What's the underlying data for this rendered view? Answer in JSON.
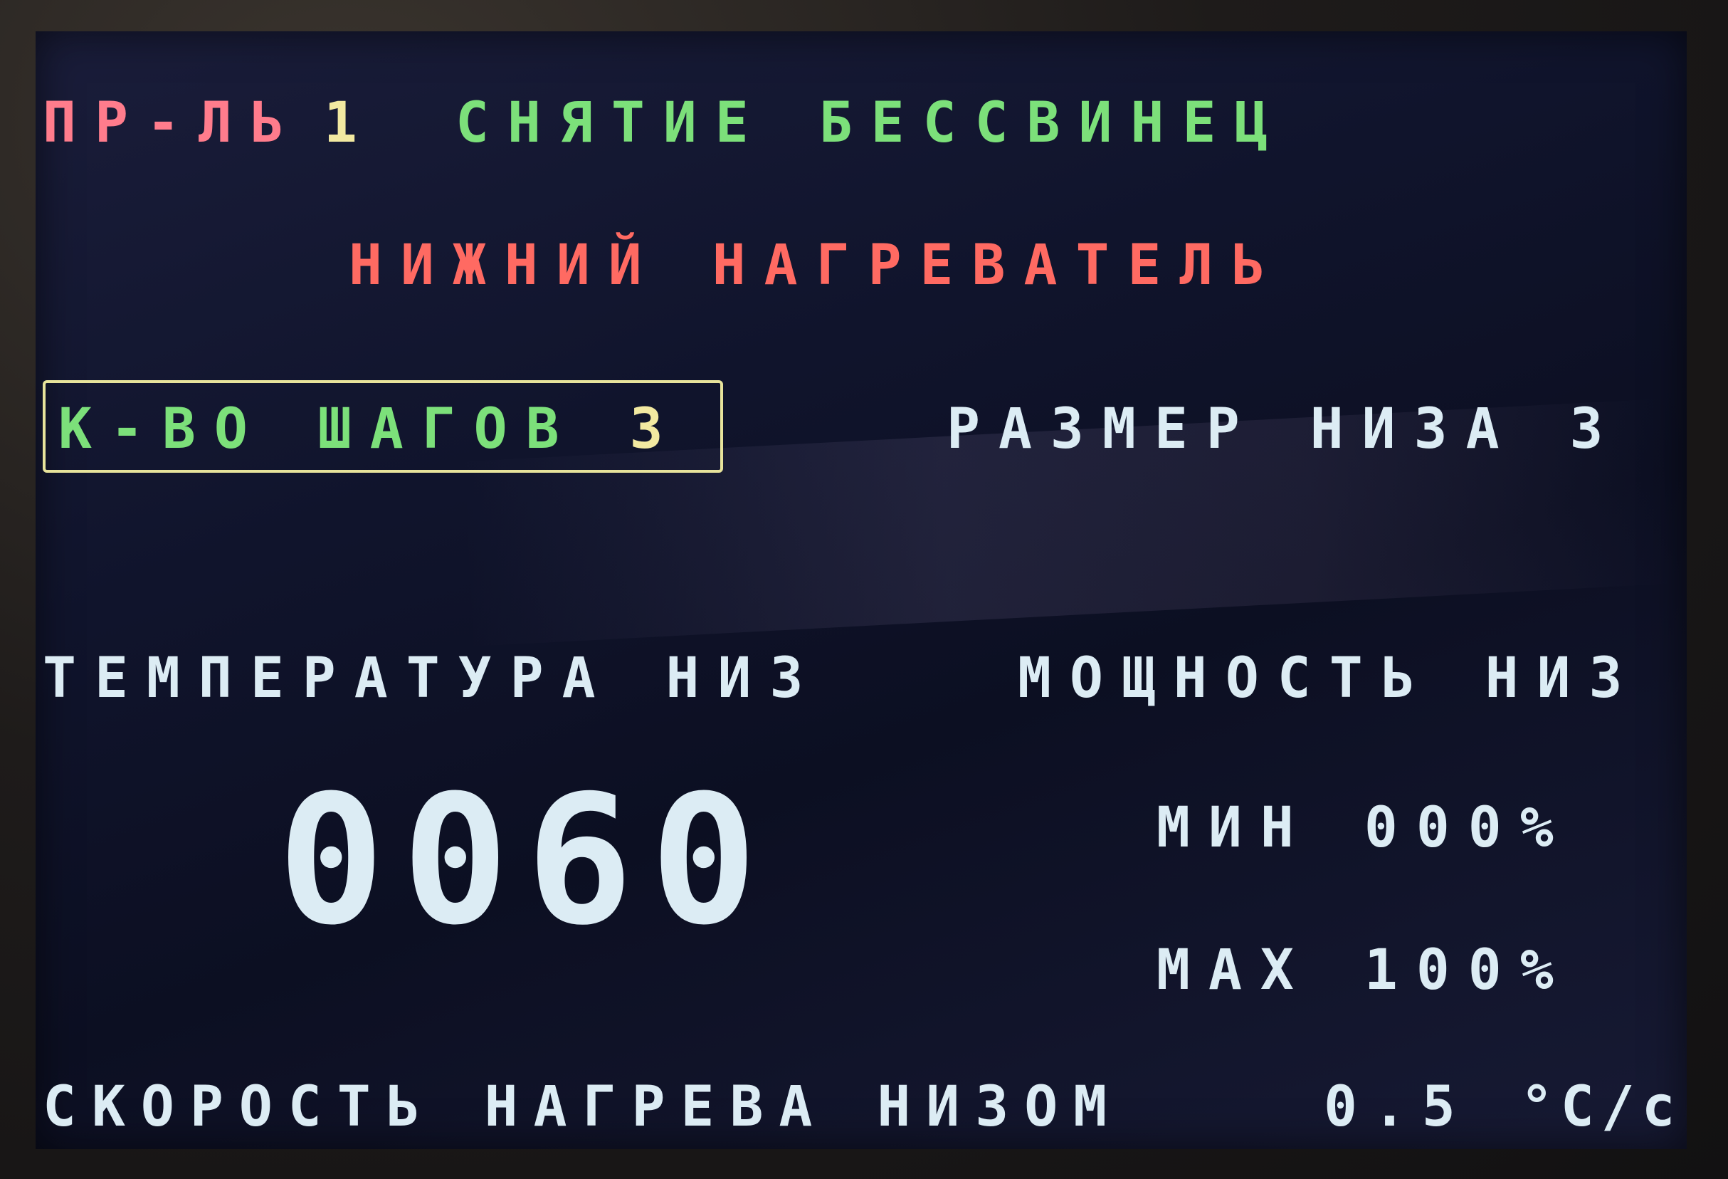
{
  "header": {
    "program_label": "ПР-ЛЬ",
    "program_number": "1",
    "program_name": "СНЯТИЕ БЕССВИНЕЦ"
  },
  "subheader": {
    "heater": "НИЖНИЙ НАГРЕВАТЕЛЬ"
  },
  "settings": {
    "steps_label": "К-ВО ШАГОВ",
    "steps_value": "3",
    "size_label": "РАЗМЕР НИЗА",
    "size_value": "3"
  },
  "temperature": {
    "label": "ТЕМПЕРАТУРА НИЗ",
    "value": "0060"
  },
  "power": {
    "label": "МОЩНОСТЬ НИЗ",
    "min_label": "МИН",
    "min_value": "000%",
    "max_label": "MAX",
    "max_value": "100%"
  },
  "heating_rate": {
    "label": "СКОРОСТЬ НАГРЕВА НИЗОМ",
    "value": "0.5",
    "unit": "°C/c"
  },
  "colors": {
    "white": "#dcecf4",
    "red": "#ff6a62",
    "pink": "#ff7c8c",
    "green": "#7ce07a",
    "yellow": "#f2e9a1",
    "background": "#10142c"
  }
}
